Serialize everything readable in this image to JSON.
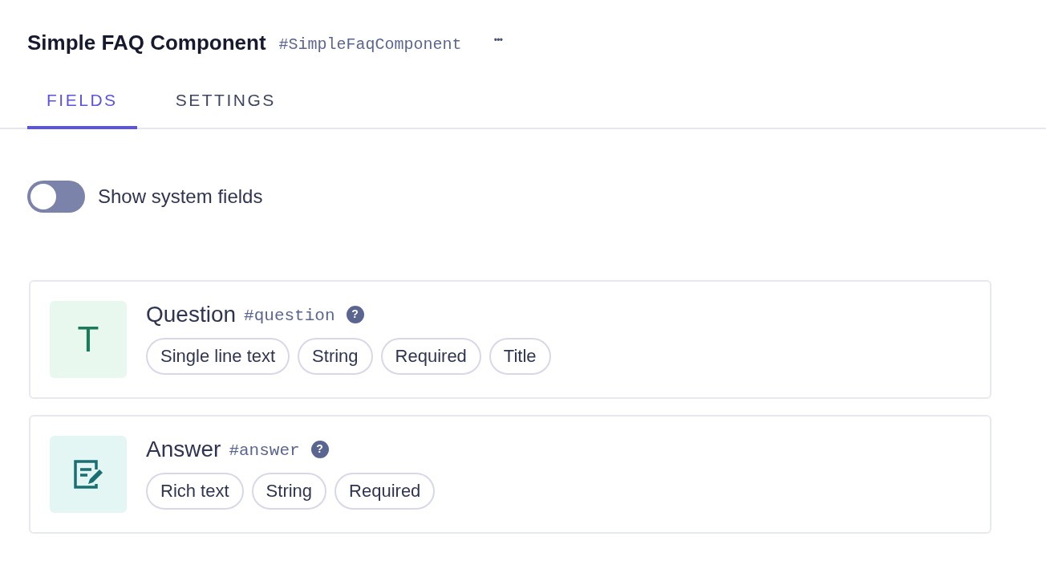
{
  "header": {
    "title": "Simple FAQ Component",
    "api_id": "#SimpleFaqComponent",
    "more": "•••"
  },
  "tabs": [
    {
      "label": "FIELDS",
      "selected": true
    },
    {
      "label": "SETTINGS",
      "selected": false
    }
  ],
  "system_fields_toggle": {
    "label": "Show system fields",
    "on": false
  },
  "fields": [
    {
      "kind": "text",
      "glyph": "T",
      "name": "Question",
      "api_id": "#question",
      "help": "?",
      "tags": [
        "Single line text",
        "String",
        "Required",
        "Title"
      ]
    },
    {
      "kind": "richtext",
      "name": "Answer",
      "api_id": "#answer",
      "help": "?",
      "tags": [
        "Rich text",
        "String",
        "Required"
      ]
    }
  ]
}
